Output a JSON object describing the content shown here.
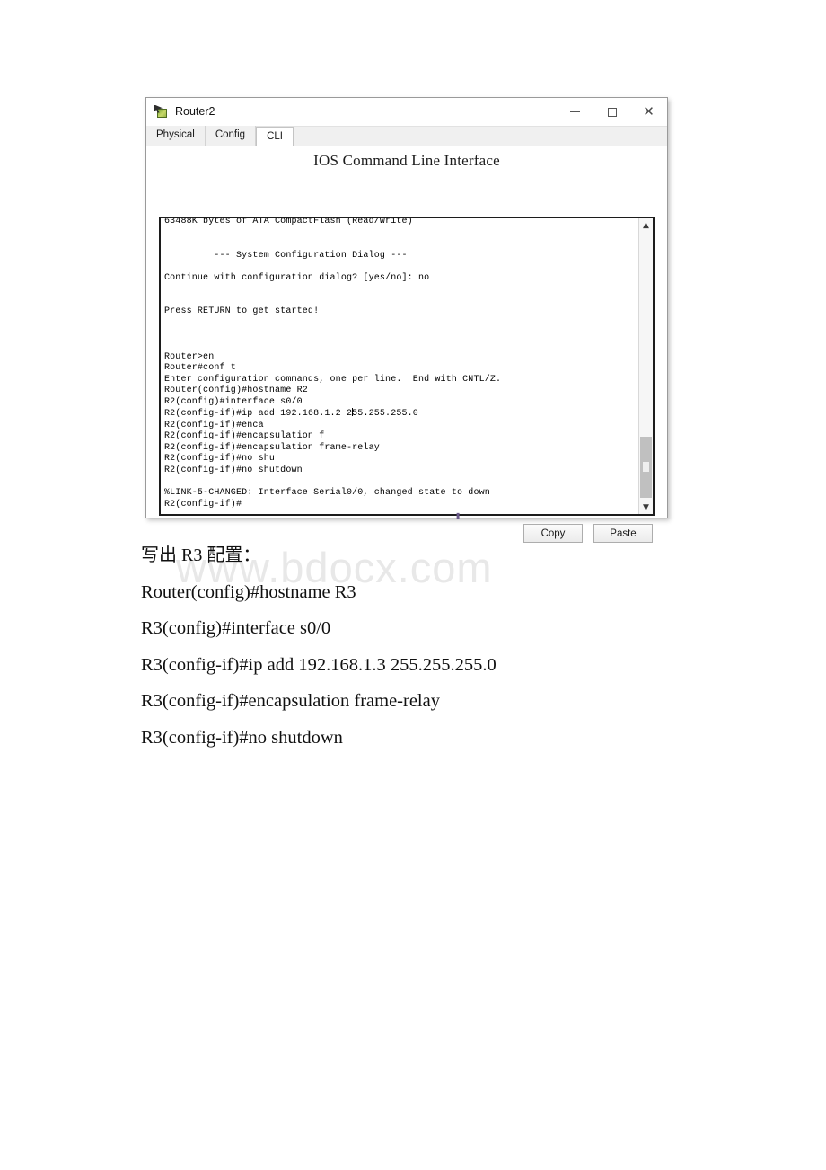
{
  "window": {
    "title": "Router2",
    "icon": "packet-tracer-router-icon",
    "controls": {
      "minimize": "minimize-icon",
      "maximize": "maximize-icon",
      "close": "close-icon"
    },
    "tabs": [
      {
        "label": "Physical",
        "active": false
      },
      {
        "label": "Config",
        "active": false
      },
      {
        "label": "CLI",
        "active": true
      }
    ],
    "heading": "IOS Command Line Interface",
    "buttons": {
      "copy": "Copy",
      "paste": "Paste"
    },
    "scrollbar": {
      "up_arrow": "chevron-up-icon",
      "down_arrow": "chevron-down-icon",
      "thumb_position": "near-bottom"
    }
  },
  "terminal": {
    "lines_before_cursor": "63488K bytes of ATA CompactFlash (Read/Write)\n\n\n         --- System Configuration Dialog ---\n\nContinue with configuration dialog? [yes/no]: no\n\n\nPress RETURN to get started!\n\n\n\nRouter>en\nRouter#conf t\nEnter configuration commands, one per line.  End with CNTL/Z.\nRouter(config)#hostname R2\nR2(config)#interface s0/0\nR2(config-if)#ip add 192.168.1.2 2",
    "lines_after_cursor": "55.255.255.0\nR2(config-if)#enca\nR2(config-if)#encapsulation f\nR2(config-if)#encapsulation frame-relay\nR2(config-if)#no shu\nR2(config-if)#no shutdown\n\n%LINK-5-CHANGED: Interface Serial0/0, changed state to down\nR2(config-if)#"
  },
  "watermark": {
    "text": "www.bdocx.com"
  },
  "document": {
    "lines": [
      "写出 R3 配置：",
      "Router(config)#hostname R3",
      "R3(config)#interface s0/0",
      "R3(config-if)#ip add 192.168.1.3 255.255.255.0",
      "R3(config-if)#encapsulation frame-relay",
      "R3(config-if)#no shutdown"
    ]
  }
}
